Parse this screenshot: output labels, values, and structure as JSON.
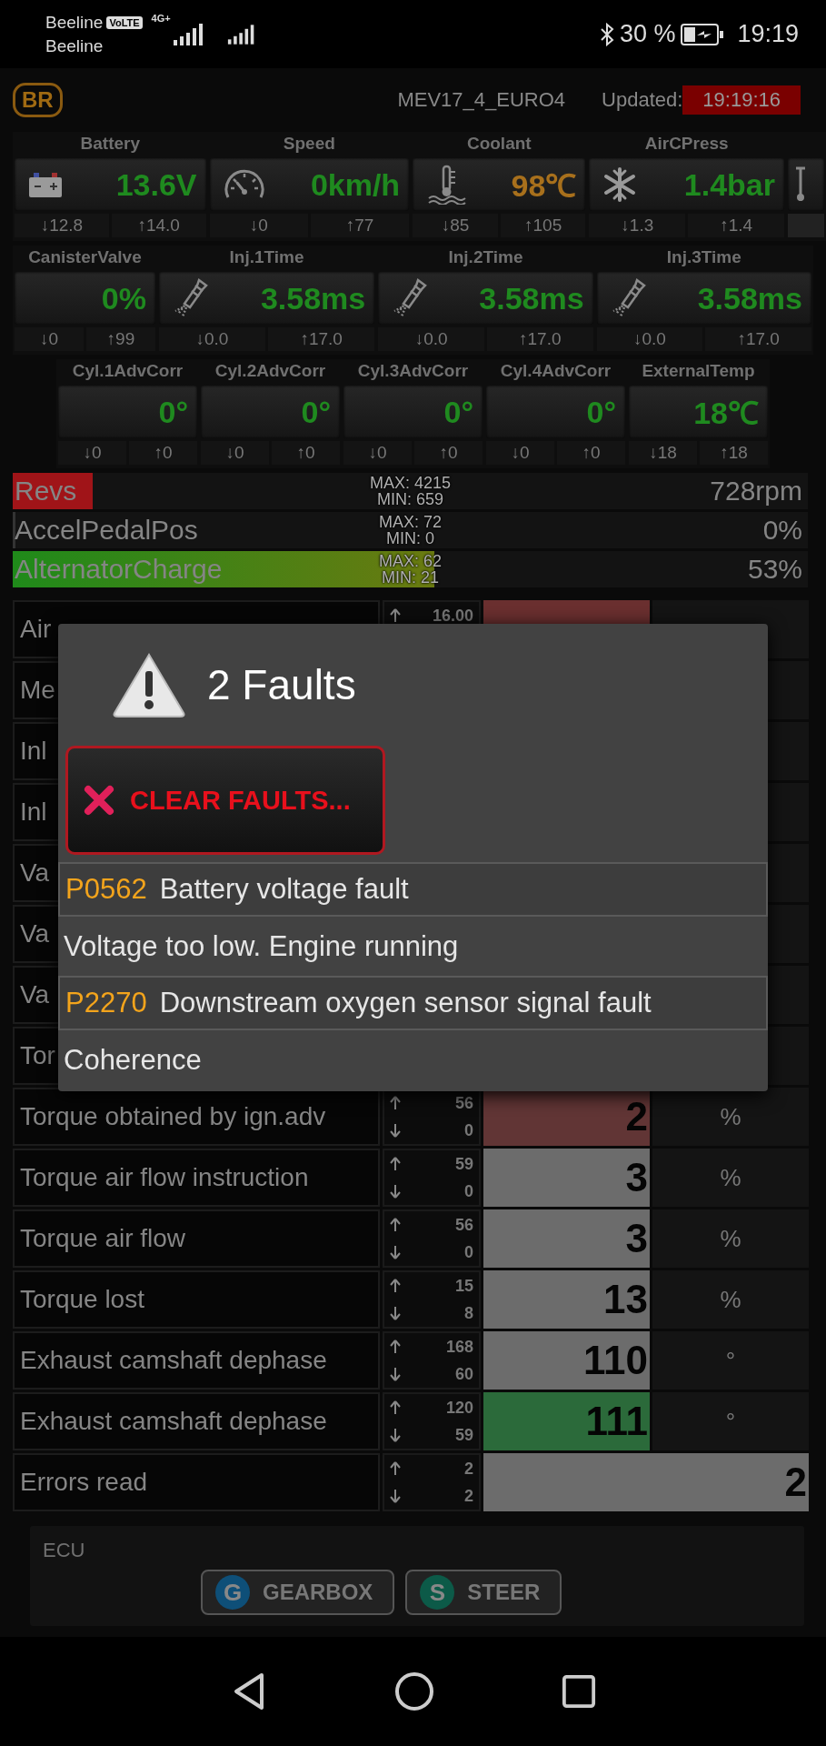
{
  "status_bar": {
    "carrier_1": "Beeline",
    "volte": "VoLTE",
    "network": "4G+",
    "carrier_2": "Beeline",
    "battery": "30 %",
    "time": "19:19"
  },
  "header": {
    "logo": "BR",
    "ecu": "MEV17_4_EURO4",
    "updated_label": "Updated:",
    "updated_time": "19:19:16"
  },
  "gauge_rows": [
    {
      "cut_tile": true,
      "gauges": [
        {
          "label": "Battery",
          "value": "13.6V",
          "color": "#1f8a1f",
          "min": "↓12.8",
          "max": "↑14.0"
        },
        {
          "label": "Speed",
          "value": "0km/h",
          "color": "#1f8a1f",
          "min": "↓0",
          "max": "↑77"
        },
        {
          "label": "Coolant",
          "value": "98℃",
          "color": "#a8701c",
          "min": "↓85",
          "max": "↑105"
        },
        {
          "label": "AirCPress",
          "value": "1.4bar",
          "color": "#1f8a1f",
          "min": "↓1.3",
          "max": "↑1.4"
        }
      ]
    },
    {
      "gauges": [
        {
          "label": "CanisterValve",
          "value": "0%",
          "color": "#1f8a1f",
          "min": "↓0",
          "max": "↑99"
        },
        {
          "label": "Inj.1Time",
          "value": "3.58ms",
          "color": "#1f8a1f",
          "min": "↓0.0",
          "max": "↑17.0"
        },
        {
          "label": "Inj.2Time",
          "value": "3.58ms",
          "color": "#1f8a1f",
          "min": "↓0.0",
          "max": "↑17.0"
        },
        {
          "label": "Inj.3Time",
          "value": "3.58ms",
          "color": "#1f8a1f",
          "min": "↓0.0",
          "max": "↑17.0"
        }
      ]
    },
    {
      "gauges": [
        {
          "label": "Cyl.1AdvCorr",
          "value": "0°",
          "color": "#1f8a1f",
          "min": "↓0",
          "max": "↑0"
        },
        {
          "label": "Cyl.2AdvCorr",
          "value": "0°",
          "color": "#1f8a1f",
          "min": "↓0",
          "max": "↑0"
        },
        {
          "label": "Cyl.3AdvCorr",
          "value": "0°",
          "color": "#1f8a1f",
          "min": "↓0",
          "max": "↑0"
        },
        {
          "label": "Cyl.4AdvCorr",
          "value": "0°",
          "color": "#1f8a1f",
          "min": "↓0",
          "max": "↑0"
        },
        {
          "label": "ExternalTemp",
          "value": "18℃",
          "color": "#1f8a1f",
          "min": "↓18",
          "max": "↑18"
        }
      ]
    }
  ],
  "bars": [
    {
      "name": "Revs",
      "max": "MAX: 4215",
      "min": "MIN: 659",
      "value": "728rpm",
      "level": 0.1,
      "color": "#a01418"
    },
    {
      "name": "AccelPedalPos",
      "max": "MAX: 72",
      "min": "MIN: 0",
      "value": "0%",
      "level": 0
    },
    {
      "name": "AlternatorCharge",
      "max": "MAX: 62",
      "min": "MIN: 21",
      "value": "53%",
      "level": 0.53,
      "color": "#1f8a1a"
    }
  ],
  "table": {
    "rows": [
      {
        "label": "Air",
        "max": "16.00",
        "color": "#6a2f2f"
      },
      {
        "label": "Me"
      },
      {
        "label": "Inl"
      },
      {
        "label": "Inl"
      },
      {
        "label": "Va"
      },
      {
        "label": "Va"
      },
      {
        "label": "Va"
      },
      {
        "label": "Tor"
      },
      {
        "label": "Torque obtained by ign.adv",
        "max": "56",
        "min": "0",
        "value": "2",
        "unit": "%",
        "color": "#613535"
      },
      {
        "label": "Torque air flow instruction",
        "max": "59",
        "min": "0",
        "value": "3",
        "unit": "%",
        "color": "#6c6c6c"
      },
      {
        "label": "Torque air flow",
        "max": "56",
        "min": "0",
        "value": "3",
        "unit": "%",
        "color": "#6c6c6c"
      },
      {
        "label": "Torque lost",
        "max": "15",
        "min": "8",
        "value": "13",
        "unit": "%",
        "color": "#6c6c6c"
      },
      {
        "label": "Exhaust camshaft dephase",
        "max": "168",
        "min": "60",
        "value": "110",
        "unit": "°",
        "color": "#6c6c6c"
      },
      {
        "label": "Exhaust camshaft dephase",
        "max": "120",
        "min": "59",
        "value": "111",
        "unit": "°",
        "color": "#2b6a3a"
      },
      {
        "label": "Errors read",
        "max": "2",
        "min": "2",
        "value": "2",
        "color": "#6c6c6c"
      }
    ]
  },
  "dialog": {
    "title": "2 Faults",
    "clear_button": "CLEAR FAULTS...",
    "faults": [
      {
        "code": "P0562",
        "description": "Battery voltage fault",
        "detail": "Voltage too low. Engine running"
      },
      {
        "code": "P2270",
        "description": "Downstream oxygen sensor signal fault",
        "detail": "Coherence"
      }
    ]
  },
  "ecu_panel": {
    "title": "ECU",
    "buttons": [
      {
        "letter": "G",
        "label": "GEARBOX",
        "color": "#0e4f78"
      },
      {
        "letter": "S",
        "label": "STEER",
        "color": "#0c5a48"
      }
    ]
  }
}
